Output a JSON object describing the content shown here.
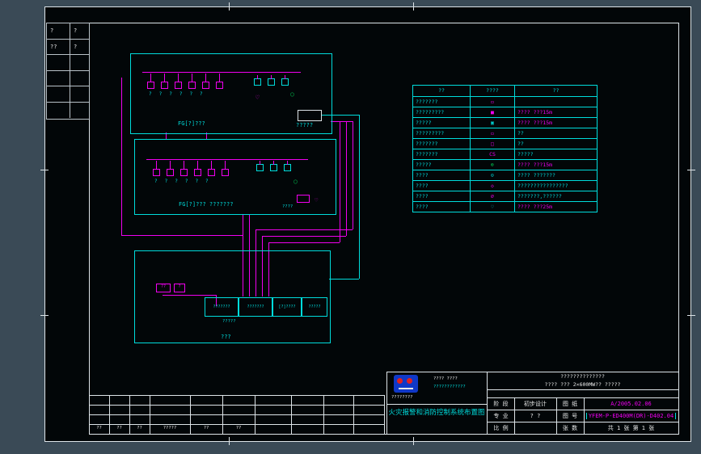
{
  "legend": {
    "headers": [
      "??",
      "????",
      "??"
    ],
    "rows": [
      {
        "name": "???????",
        "sym": "▭",
        "sym_color": "#f000f0",
        "desc": "",
        "desc_color": "#00dcdc"
      },
      {
        "name": "?????????",
        "sym": "■",
        "sym_color": "#f000f0",
        "desc": "???? ???15m",
        "desc_color": "#f000f0"
      },
      {
        "name": "?????",
        "sym": "▣",
        "sym_color": "#00dcdc",
        "desc": "???? ???15m",
        "desc_color": "#f000f0"
      },
      {
        "name": "?????????",
        "sym": "▭",
        "sym_color": "#f000f0",
        "desc": "??",
        "desc_color": "#00dcdc"
      },
      {
        "name": "???????",
        "sym": "□",
        "sym_color": "#f000f0",
        "desc": "??",
        "desc_color": "#00dcdc"
      },
      {
        "name": "???????",
        "sym": "CS",
        "sym_color": "#f000f0",
        "desc": "?????",
        "desc_color": "#00dcdc"
      },
      {
        "name": "?????",
        "sym": "⊕",
        "sym_color": "#00b84a",
        "desc": "???? ???15m",
        "desc_color": "#f000f0"
      },
      {
        "name": "????",
        "sym": "⊙",
        "sym_color": "#00dcdc",
        "desc": "???? ???????",
        "desc_color": "#00dcdc"
      },
      {
        "name": "????",
        "sym": "◇",
        "sym_color": "#f000f0",
        "desc": "????????????????",
        "desc_color": "#00dcdc"
      },
      {
        "name": "????",
        "sym": "⌀",
        "sym_color": "#f000f0",
        "desc": "???????,??????",
        "desc_color": "#00dcdc"
      },
      {
        "name": "????",
        "sym": "♡",
        "sym_color": "#00dcdc",
        "desc": "???? ???25m",
        "desc_color": "#f000f0"
      }
    ]
  },
  "corner_table": {
    "rows": [
      [
        "?",
        "?"
      ],
      [
        "??",
        "?"
      ],
      [
        "",
        ""
      ],
      [
        "",
        ""
      ],
      [
        "",
        ""
      ],
      [
        "",
        ""
      ]
    ]
  },
  "boxA": {
    "label": "FG[?]???",
    "caption": "??????",
    "white_box_label": "?????"
  },
  "boxB": {
    "label": "FG[?]??? ???????",
    "caption": "??????",
    "tag": "????"
  },
  "boxC": {
    "label": "???",
    "cells": [
      "???????",
      "???????",
      "[?]????",
      "?????"
    ],
    "sub_label": "?????",
    "relay1": "??",
    "relay2": "?"
  },
  "title_block": {
    "logo_caption": "????????",
    "side_line1": "???? ????",
    "side_line2": "????????????",
    "company_line1": "??????????????",
    "company_line2": "???? ??? 2×600MW?? ?????",
    "drawing_title": "火灾报警和消防控制系统布置图",
    "rows": [
      {
        "l1": "阶 段",
        "v1": "初步设计",
        "l2": "图 纸",
        "v2": "A/2005.02.06",
        "v2_color": "#f000f0",
        "hl": false
      },
      {
        "l1": "专 业",
        "v1": "? ?",
        "l2": "图 号",
        "v2": "YFEM-P-ED400M(DR)-D402.04",
        "v2_color": "#f000f0",
        "hl": true
      },
      {
        "l1": "比 例",
        "v1": "",
        "l2": "张 数",
        "v2": "共 1 张 第 1 张",
        "v2_color": "#e8e8e8",
        "hl": false
      }
    ]
  },
  "revision_table": {
    "bottom_labels": [
      "??",
      "??",
      "??",
      "?????",
      "??",
      "??"
    ]
  }
}
